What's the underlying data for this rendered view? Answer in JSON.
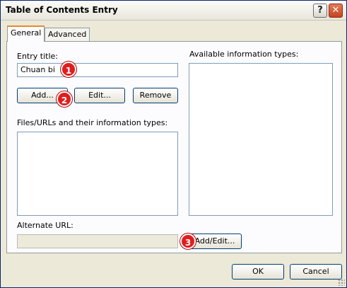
{
  "window": {
    "title": "Table of Contents Entry"
  },
  "titlebar": {
    "help_label": "?",
    "close_label": "✕"
  },
  "tabs": [
    {
      "label": "General"
    },
    {
      "label": "Advanced"
    }
  ],
  "general": {
    "entry_title_label": "Entry title:",
    "entry_title_value": "Chuan bi",
    "add_label": "Add...",
    "edit_label": "Edit...",
    "remove_label": "Remove",
    "files_label": "Files/URLs and their information types:",
    "available_label": "Available information types:",
    "alternate_url_label": "Alternate URL:",
    "alternate_url_value": "",
    "add_edit_label": "Add/Edit..."
  },
  "footer": {
    "ok_label": "OK",
    "cancel_label": "Cancel"
  },
  "annotations": [
    {
      "number": "1"
    },
    {
      "number": "2"
    },
    {
      "number": "3"
    }
  ],
  "colors": {
    "badge": "#e01e1e",
    "accent_tab": "#e68b2c",
    "dialog_bg": "#ece9d8"
  }
}
